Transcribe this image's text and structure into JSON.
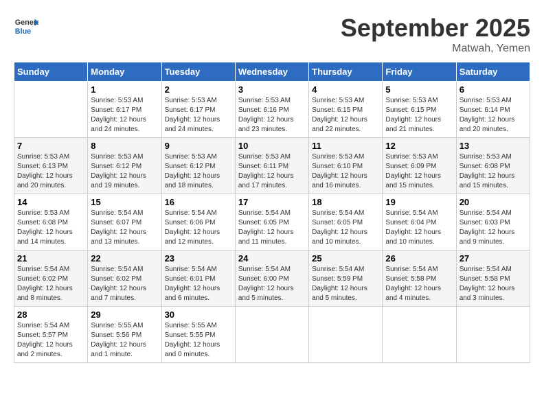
{
  "logo": {
    "line1": "General",
    "line2": "Blue"
  },
  "title": "September 2025",
  "location": "Matwah, Yemen",
  "weekdays": [
    "Sunday",
    "Monday",
    "Tuesday",
    "Wednesday",
    "Thursday",
    "Friday",
    "Saturday"
  ],
  "weeks": [
    [
      {
        "day": "",
        "info": ""
      },
      {
        "day": "1",
        "info": "Sunrise: 5:53 AM\nSunset: 6:17 PM\nDaylight: 12 hours\nand 24 minutes."
      },
      {
        "day": "2",
        "info": "Sunrise: 5:53 AM\nSunset: 6:17 PM\nDaylight: 12 hours\nand 24 minutes."
      },
      {
        "day": "3",
        "info": "Sunrise: 5:53 AM\nSunset: 6:16 PM\nDaylight: 12 hours\nand 23 minutes."
      },
      {
        "day": "4",
        "info": "Sunrise: 5:53 AM\nSunset: 6:15 PM\nDaylight: 12 hours\nand 22 minutes."
      },
      {
        "day": "5",
        "info": "Sunrise: 5:53 AM\nSunset: 6:15 PM\nDaylight: 12 hours\nand 21 minutes."
      },
      {
        "day": "6",
        "info": "Sunrise: 5:53 AM\nSunset: 6:14 PM\nDaylight: 12 hours\nand 20 minutes."
      }
    ],
    [
      {
        "day": "7",
        "info": "Sunrise: 5:53 AM\nSunset: 6:13 PM\nDaylight: 12 hours\nand 20 minutes."
      },
      {
        "day": "8",
        "info": "Sunrise: 5:53 AM\nSunset: 6:12 PM\nDaylight: 12 hours\nand 19 minutes."
      },
      {
        "day": "9",
        "info": "Sunrise: 5:53 AM\nSunset: 6:12 PM\nDaylight: 12 hours\nand 18 minutes."
      },
      {
        "day": "10",
        "info": "Sunrise: 5:53 AM\nSunset: 6:11 PM\nDaylight: 12 hours\nand 17 minutes."
      },
      {
        "day": "11",
        "info": "Sunrise: 5:53 AM\nSunset: 6:10 PM\nDaylight: 12 hours\nand 16 minutes."
      },
      {
        "day": "12",
        "info": "Sunrise: 5:53 AM\nSunset: 6:09 PM\nDaylight: 12 hours\nand 15 minutes."
      },
      {
        "day": "13",
        "info": "Sunrise: 5:53 AM\nSunset: 6:08 PM\nDaylight: 12 hours\nand 15 minutes."
      }
    ],
    [
      {
        "day": "14",
        "info": "Sunrise: 5:53 AM\nSunset: 6:08 PM\nDaylight: 12 hours\nand 14 minutes."
      },
      {
        "day": "15",
        "info": "Sunrise: 5:54 AM\nSunset: 6:07 PM\nDaylight: 12 hours\nand 13 minutes."
      },
      {
        "day": "16",
        "info": "Sunrise: 5:54 AM\nSunset: 6:06 PM\nDaylight: 12 hours\nand 12 minutes."
      },
      {
        "day": "17",
        "info": "Sunrise: 5:54 AM\nSunset: 6:05 PM\nDaylight: 12 hours\nand 11 minutes."
      },
      {
        "day": "18",
        "info": "Sunrise: 5:54 AM\nSunset: 6:05 PM\nDaylight: 12 hours\nand 10 minutes."
      },
      {
        "day": "19",
        "info": "Sunrise: 5:54 AM\nSunset: 6:04 PM\nDaylight: 12 hours\nand 10 minutes."
      },
      {
        "day": "20",
        "info": "Sunrise: 5:54 AM\nSunset: 6:03 PM\nDaylight: 12 hours\nand 9 minutes."
      }
    ],
    [
      {
        "day": "21",
        "info": "Sunrise: 5:54 AM\nSunset: 6:02 PM\nDaylight: 12 hours\nand 8 minutes."
      },
      {
        "day": "22",
        "info": "Sunrise: 5:54 AM\nSunset: 6:02 PM\nDaylight: 12 hours\nand 7 minutes."
      },
      {
        "day": "23",
        "info": "Sunrise: 5:54 AM\nSunset: 6:01 PM\nDaylight: 12 hours\nand 6 minutes."
      },
      {
        "day": "24",
        "info": "Sunrise: 5:54 AM\nSunset: 6:00 PM\nDaylight: 12 hours\nand 5 minutes."
      },
      {
        "day": "25",
        "info": "Sunrise: 5:54 AM\nSunset: 5:59 PM\nDaylight: 12 hours\nand 5 minutes."
      },
      {
        "day": "26",
        "info": "Sunrise: 5:54 AM\nSunset: 5:58 PM\nDaylight: 12 hours\nand 4 minutes."
      },
      {
        "day": "27",
        "info": "Sunrise: 5:54 AM\nSunset: 5:58 PM\nDaylight: 12 hours\nand 3 minutes."
      }
    ],
    [
      {
        "day": "28",
        "info": "Sunrise: 5:54 AM\nSunset: 5:57 PM\nDaylight: 12 hours\nand 2 minutes."
      },
      {
        "day": "29",
        "info": "Sunrise: 5:55 AM\nSunset: 5:56 PM\nDaylight: 12 hours\nand 1 minute."
      },
      {
        "day": "30",
        "info": "Sunrise: 5:55 AM\nSunset: 5:55 PM\nDaylight: 12 hours\nand 0 minutes."
      },
      {
        "day": "",
        "info": ""
      },
      {
        "day": "",
        "info": ""
      },
      {
        "day": "",
        "info": ""
      },
      {
        "day": "",
        "info": ""
      }
    ]
  ]
}
